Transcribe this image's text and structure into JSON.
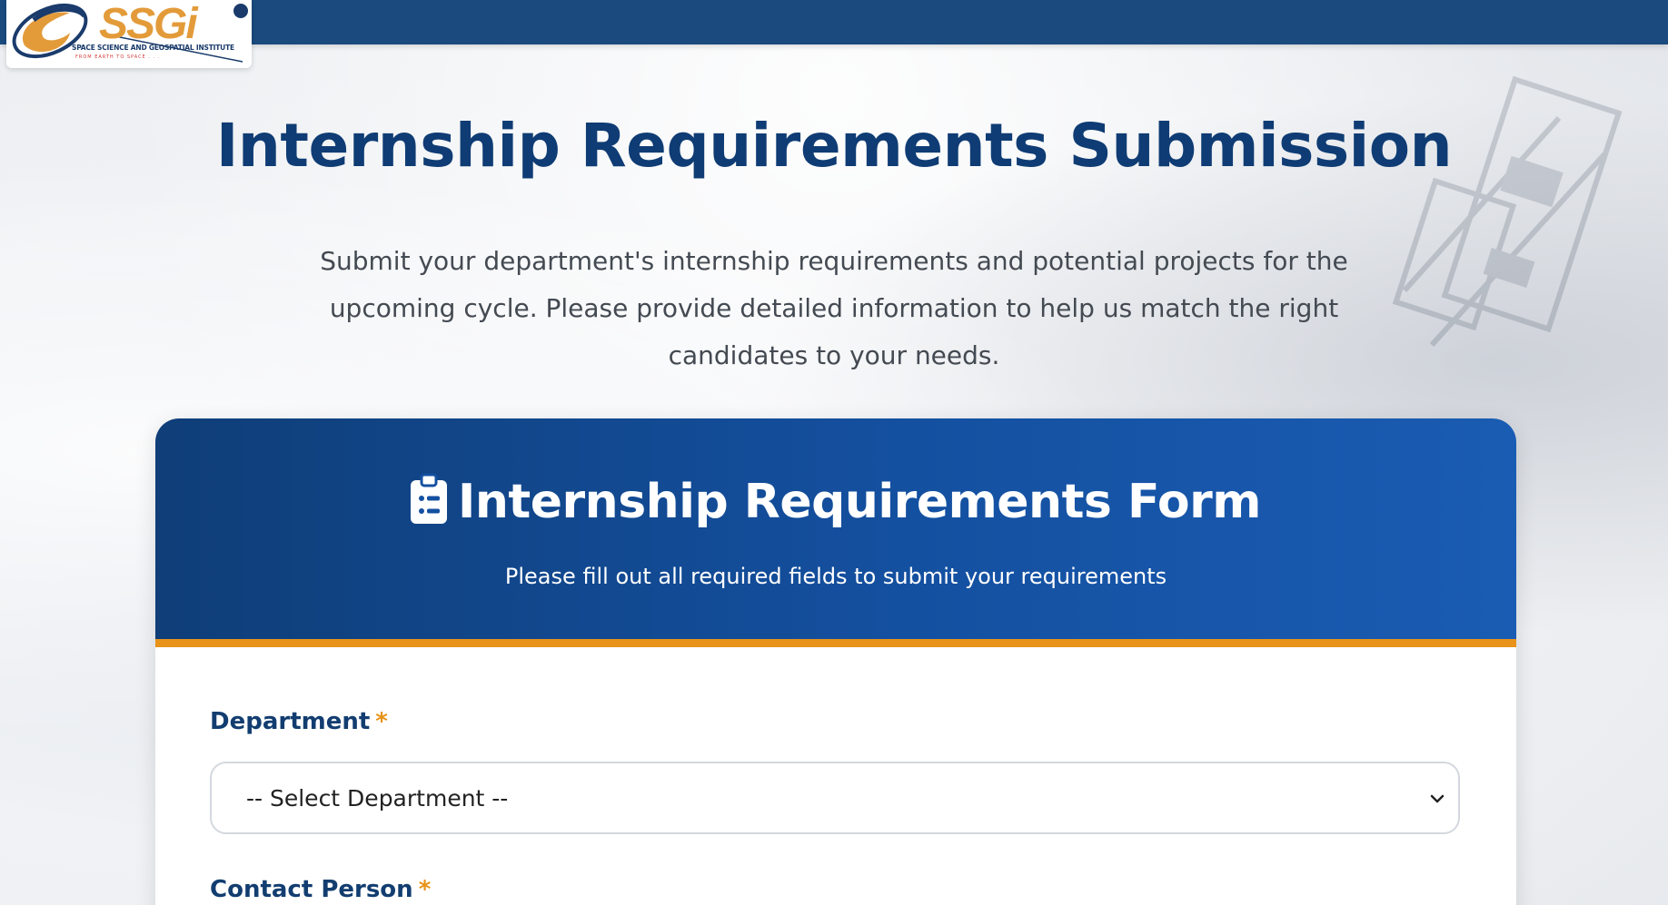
{
  "logo": {
    "brand": "SSGi",
    "institute": "SPACE SCIENCE AND GEOSPATIAL INSTITUTE",
    "tagline": "FROM EARTH TO SPACE . . ."
  },
  "page": {
    "title": "Internship Requirements Submission",
    "description": "Submit your department's internship requirements and potential projects for the upcoming cycle. Please provide detailed information to help us match the right candidates to your needs."
  },
  "form": {
    "title": "Internship Requirements Form",
    "subtitle": "Please fill out all required fields to submit your requirements",
    "header_icon": "clipboard-list-icon",
    "fields": [
      {
        "label": "Department",
        "required_mark": "*",
        "type": "select",
        "value": "-- Select Department --"
      },
      {
        "label": "Contact Person",
        "required_mark": "*"
      }
    ]
  },
  "colors": {
    "navy": "#0f3c74",
    "top_bar": "#1a4a7e",
    "header_gradient_start": "#0f3e78",
    "header_gradient_end": "#1a5cb3",
    "accent_orange": "#e8931a",
    "label": "#123d70"
  }
}
